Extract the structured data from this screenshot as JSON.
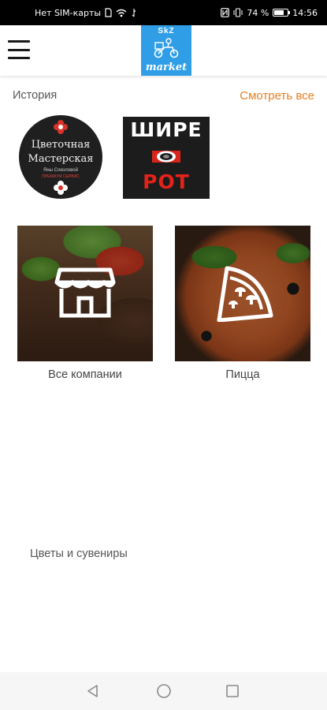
{
  "status_bar": {
    "carrier": "Нет SIM-карты",
    "battery_percent": "74 %",
    "battery_level": 0.74,
    "time": "14:56"
  },
  "header": {
    "menu_icon": "hamburger-menu-icon",
    "logo": {
      "top_text": "SkZ",
      "bottom_text": "market",
      "background": "#2f9ee6"
    }
  },
  "stories": {
    "title": "История",
    "view_all_label": "Смотреть все",
    "accent_color": "#e67e22",
    "items": [
      {
        "line1": "Цветочная",
        "line2": "Мастерская",
        "line3": "Яны Соколовой",
        "line4": "ПРЕМИУМ СЕРВИС"
      },
      {
        "line1": "ШИРЕ",
        "line2": "РОТ"
      }
    ]
  },
  "categories": [
    {
      "label": "Все компании",
      "icon": "storefront-icon"
    },
    {
      "label": "Пицца",
      "icon": "pizza-slice-icon"
    }
  ],
  "bottom_section": {
    "title": "Цветы и сувениры"
  },
  "nav_bar": {
    "icons": [
      "back-triangle-icon",
      "home-circle-icon",
      "recent-square-icon"
    ]
  }
}
